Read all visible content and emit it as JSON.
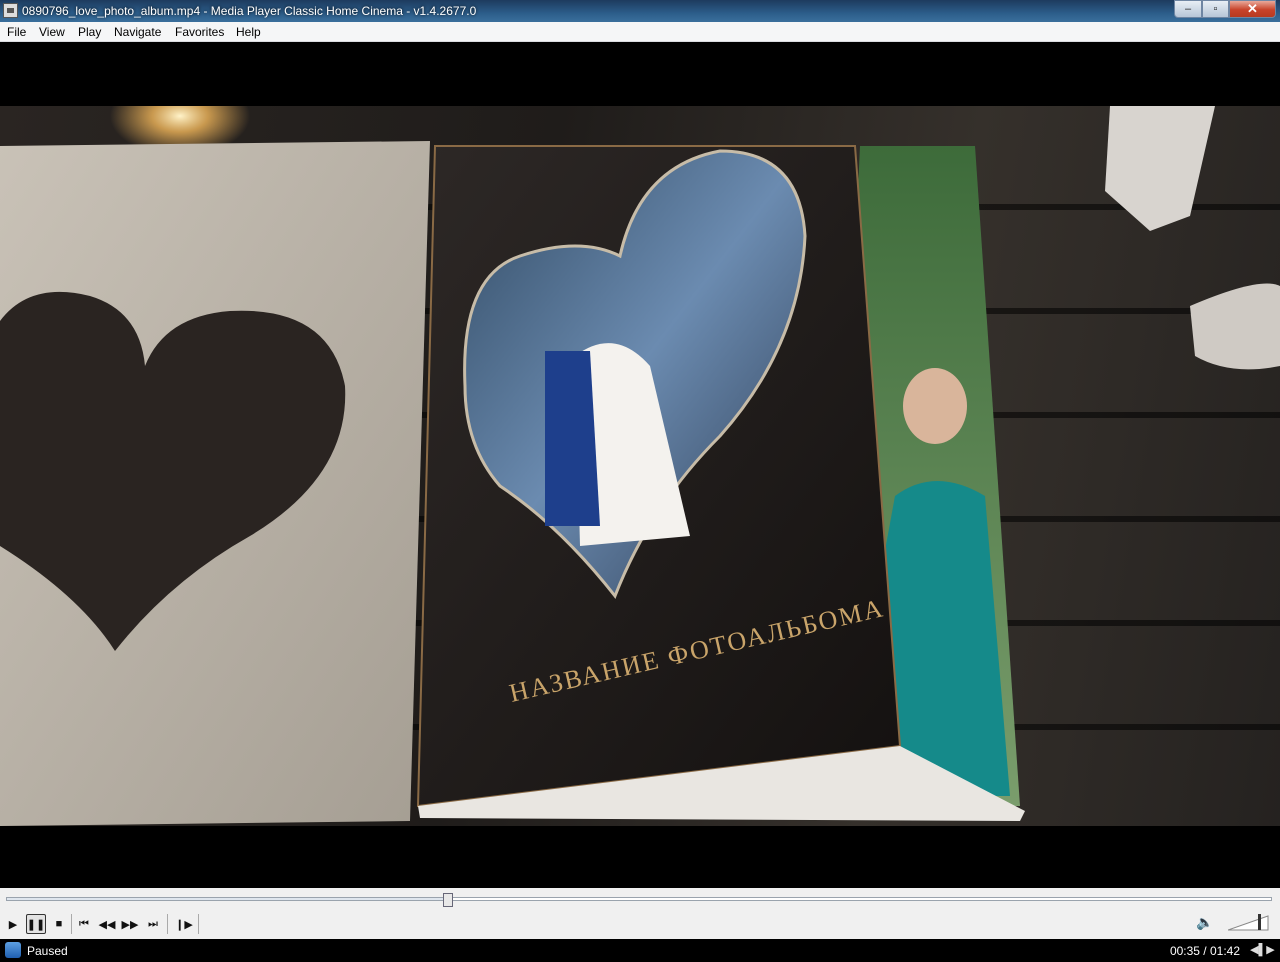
{
  "window": {
    "title": "0890796_love_photo_album.mp4 - Media Player Classic Home Cinema - v1.4.2677.0",
    "minimize_glyph": "–",
    "maximize_glyph": "▫",
    "close_glyph": "✕"
  },
  "menu": {
    "items": [
      "File",
      "View",
      "Play",
      "Navigate",
      "Favorites",
      "Help"
    ]
  },
  "video": {
    "album_title": "НАЗВАНИЕ ФОТОАЛЬБОМА"
  },
  "seek": {
    "position_fraction": 0.349
  },
  "controls": {
    "play_icon": "play-icon",
    "pause_icon": "pause-icon",
    "stop_icon": "stop-icon",
    "prev_icon": "skip-back-icon",
    "rewind_icon": "rewind-icon",
    "forward_icon": "fast-forward-icon",
    "next_icon": "skip-forward-icon",
    "frame_step_icon": "frame-step-icon",
    "volume_icon": "speaker-icon"
  },
  "status": {
    "state": "Paused",
    "time": "00:35 / 01:42"
  }
}
